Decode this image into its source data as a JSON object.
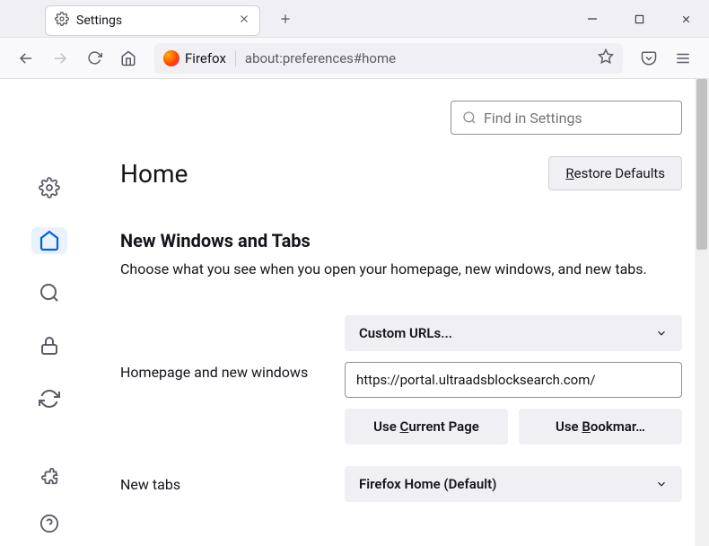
{
  "tab": {
    "title": "Settings"
  },
  "urlbar": {
    "identity": "Firefox",
    "url": "about:preferences#home"
  },
  "search": {
    "placeholder": "Find in Settings"
  },
  "page": {
    "title": "Home",
    "restore": "estore Defaults",
    "restore_accel": "R"
  },
  "section": {
    "title": "New Windows and Tabs",
    "desc": "Choose what you see when you open your homepage, new windows, and new tabs."
  },
  "homepage": {
    "label": "Homepage and new windows",
    "dropdown": "Custom URLs...",
    "url_value": "https://portal.ultraadsblocksearch.com/",
    "use_current_pre": "Use ",
    "use_current_accel": "C",
    "use_current_post": "urrent Page",
    "use_bookmark_pre": "Use ",
    "use_bookmark_accel": "B",
    "use_bookmark_post": "ookmar…"
  },
  "newtabs": {
    "label": "New tabs",
    "dropdown": "Firefox Home (Default)"
  }
}
